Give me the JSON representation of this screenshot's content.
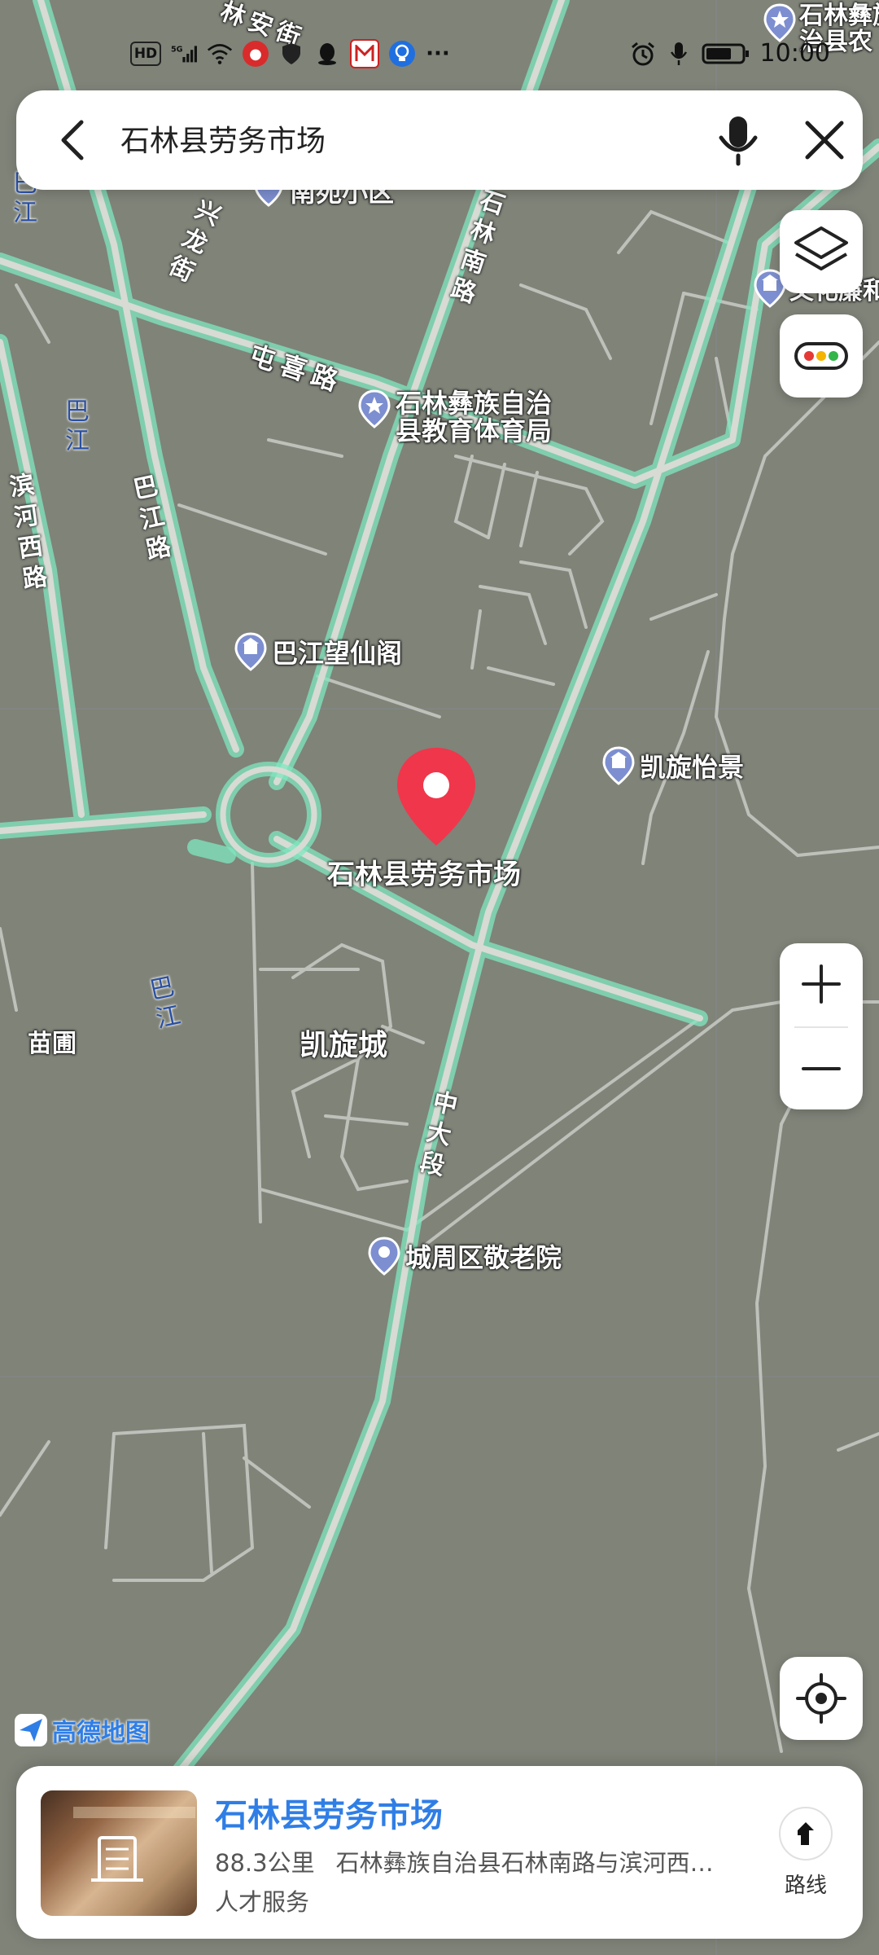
{
  "status_bar": {
    "left_icons": [
      "hd-icon",
      "5g-signal-icon",
      "wifi-icon",
      "app-notification-icon",
      "shield-icon",
      "qq-icon",
      "map-app-icon",
      "bulb-icon",
      "more-dots-icon"
    ],
    "hd_text": "HD",
    "net_text": "5G",
    "right_icons": [
      "alarm-icon",
      "mic-icon",
      "battery-icon"
    ],
    "time": "10:00"
  },
  "search": {
    "query": "石林县劳务市场",
    "back_icon": "back-chevron-icon",
    "mic_icon": "mic-icon",
    "close_icon": "close-icon"
  },
  "map": {
    "roads": [
      {
        "name": "林安街"
      },
      {
        "name": "石林南路"
      },
      {
        "name": "兴龙街"
      },
      {
        "name": "屯喜路"
      },
      {
        "name": "巴江路"
      },
      {
        "name": "滨河西路"
      },
      {
        "name": "中大段"
      }
    ],
    "water": [
      {
        "name": "巴江"
      },
      {
        "name": "巴江"
      },
      {
        "name": "巴江"
      }
    ],
    "pois": [
      {
        "name": "南苑小区",
        "type": "pin"
      },
      {
        "name": "石林彝族自治\n县教育体育局",
        "type": "star"
      },
      {
        "name": "巴江望仙阁",
        "type": "building"
      },
      {
        "name": "凯旋怡景",
        "type": "building"
      },
      {
        "name": "城周区敬老院",
        "type": "pin"
      },
      {
        "name": "石林彝族自\n治县农",
        "type": "star"
      },
      {
        "name": "文化廉和",
        "type": "building"
      }
    ],
    "areas": [
      {
        "name": "凯旋城"
      },
      {
        "name": "苗圃"
      }
    ],
    "selected_marker_label": "石林县劳务市场",
    "logo_text": "高德地图"
  },
  "controls": {
    "layers_icon": "layers-icon",
    "traffic_icon": "traffic-light-icon",
    "zoom_in_icon": "plus-icon",
    "zoom_out_icon": "minus-icon",
    "locate_icon": "locate-crosshair-icon"
  },
  "card": {
    "title": "石林县劳务市场",
    "distance": "88.3公里",
    "address": "石林彝族自治县石林南路与滨河西…",
    "category": "人才服务",
    "route_label": "路线",
    "route_icon": "route-arrow-icon",
    "thumbnail_icon": "building-thumbnail"
  },
  "colors": {
    "map_bg": "#7f8378",
    "road_glow": "#7fe7c0",
    "marker_red": "#f0364b",
    "accent_blue": "#2f7ee6"
  }
}
